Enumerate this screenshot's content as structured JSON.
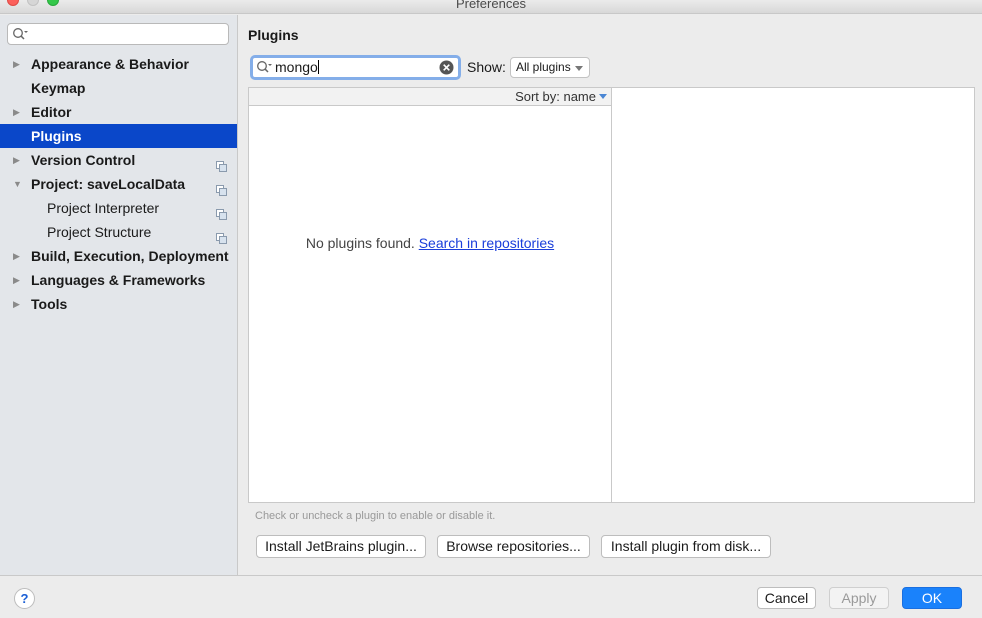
{
  "window": {
    "title": "Preferences"
  },
  "sidebar": {
    "search_value": "",
    "items": [
      {
        "label": "Appearance & Behavior",
        "arrow": "▶"
      },
      {
        "label": "Keymap",
        "arrow": ""
      },
      {
        "label": "Editor",
        "arrow": "▶"
      },
      {
        "label": "Plugins",
        "arrow": "",
        "selected": true
      },
      {
        "label": "Version Control",
        "arrow": "▶"
      },
      {
        "label": "Project: saveLocalData",
        "arrow": "▼"
      },
      {
        "label": "Project Interpreter",
        "arrow": ""
      },
      {
        "label": "Project Structure",
        "arrow": ""
      },
      {
        "label": "Build, Execution, Deployment",
        "arrow": "▶"
      },
      {
        "label": "Languages & Frameworks",
        "arrow": "▶"
      },
      {
        "label": "Tools",
        "arrow": "▶"
      }
    ]
  },
  "main": {
    "title": "Plugins",
    "search_value": "mongo",
    "show_label": "Show:",
    "show_selected": "All plugins",
    "sort_label": "Sort by: name",
    "empty_text": "No plugins found.",
    "empty_link": "Search in repositories",
    "hint": "Check or uncheck a plugin to enable or disable it.",
    "buttons": {
      "install_jetbrains": "Install JetBrains plugin...",
      "browse": "Browse repositories...",
      "install_disk": "Install plugin from disk..."
    }
  },
  "footer": {
    "help": "?",
    "cancel": "Cancel",
    "apply": "Apply",
    "ok": "OK"
  },
  "colors": {
    "selection": "#0a47c9",
    "ok_button": "#1a82fb",
    "link": "#1a3edb"
  }
}
